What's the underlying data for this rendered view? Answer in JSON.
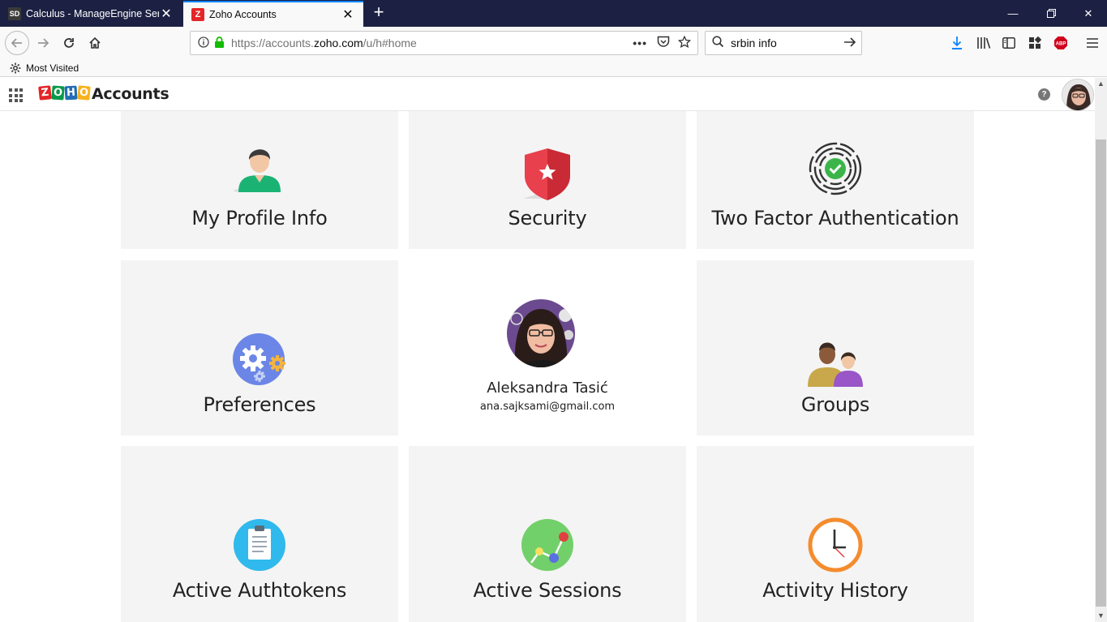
{
  "browser": {
    "tabs": [
      {
        "favicon": "SD",
        "title": "Calculus - ManageEngine Servi",
        "active": false
      },
      {
        "favicon": "Z",
        "title": "Zoho Accounts",
        "active": true
      }
    ],
    "url": {
      "prefix": "https://accounts.",
      "domain": "zoho.com",
      "path": "/u/h#home"
    },
    "search_value": "srbin info",
    "bookmarks": [
      {
        "label": "Most Visited"
      }
    ]
  },
  "app": {
    "logo_letters": [
      "Z",
      "O",
      "H",
      "O"
    ],
    "logo_colors": [
      "#e42527",
      "#089949",
      "#226db4",
      "#f9b21d"
    ],
    "title": "Accounts",
    "help_label": "?"
  },
  "tiles": {
    "profile_info": {
      "label": "My Profile Info",
      "icon": "user-icon"
    },
    "security": {
      "label": "Security",
      "icon": "shield-icon"
    },
    "two_factor": {
      "label": "Two Factor Authentication",
      "icon": "fingerprint-icon"
    },
    "preferences": {
      "label": "Preferences",
      "icon": "gears-icon"
    },
    "profile_card": {
      "name": "Aleksandra Tasić",
      "email": "ana.sajksami@gmail.com"
    },
    "groups": {
      "label": "Groups",
      "icon": "group-icon"
    },
    "authtokens": {
      "label": "Active Authtokens",
      "icon": "clipboard-icon"
    },
    "sessions": {
      "label": "Active Sessions",
      "icon": "sessions-icon"
    },
    "activity": {
      "label": "Activity History",
      "icon": "clock-icon"
    }
  },
  "colors": {
    "tabbar": "#1c2143",
    "accent": "#0a84ff",
    "tile_bg": "#f4f4f4"
  }
}
